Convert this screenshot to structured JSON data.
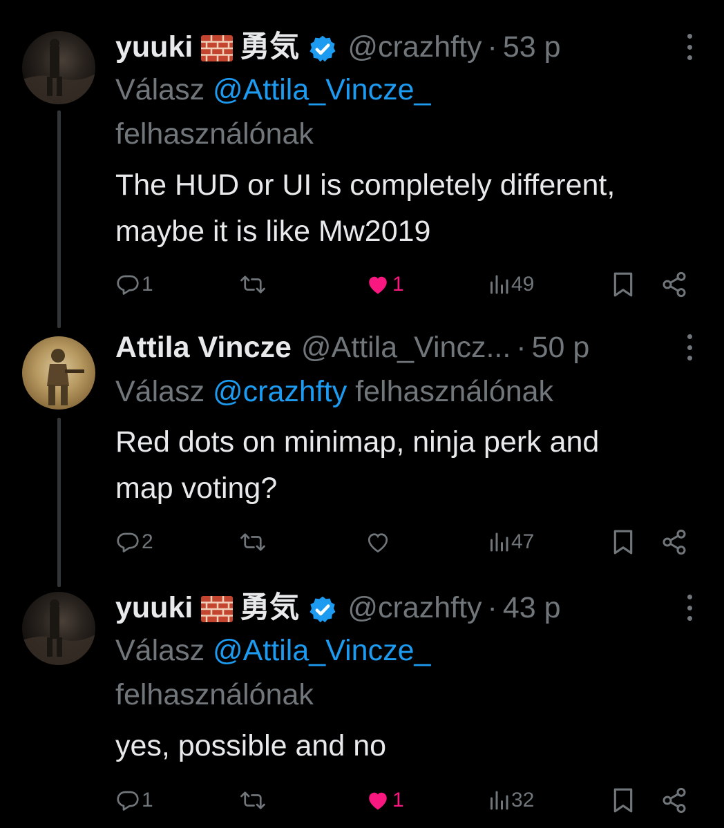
{
  "tweets": [
    {
      "name": "yuuki",
      "kanji": "勇気",
      "handle": "@crazhfty",
      "time": "53 p",
      "reply_prefix": "Válasz",
      "reply_mention": "@Attila_Vincze_",
      "reply_suffix": "felhasználónak",
      "text_lines": [
        "The HUD or UI is completely different,",
        "maybe it is like Mw2019"
      ],
      "replies": "1",
      "reposts": "",
      "likes": "1",
      "liked": true,
      "views": "49"
    },
    {
      "name": "Attila Vincze",
      "handle": "@Attila_Vincz...",
      "time": "50 p",
      "reply_prefix": "Válasz",
      "reply_mention": "@crazhfty",
      "reply_suffix": "felhasználónak",
      "text_lines": [
        "Red dots on minimap, ninja perk and",
        "map voting?"
      ],
      "replies": "2",
      "reposts": "",
      "likes": "",
      "liked": false,
      "views": "47"
    },
    {
      "name": "yuuki",
      "kanji": "勇気",
      "handle": "@crazhfty",
      "time": "43 p",
      "reply_prefix": "Válasz",
      "reply_mention": "@Attila_Vincze_",
      "reply_suffix": "felhasználónak",
      "text_lines": [
        "yes, possible and no"
      ],
      "replies": "1",
      "reposts": "",
      "likes": "1",
      "liked": true,
      "views": "32"
    }
  ],
  "separator": "·",
  "icons": {
    "reply": "reply-icon",
    "repost": "repost-icon",
    "like": "heart-icon",
    "views": "views-icon",
    "bookmark": "bookmark-icon",
    "share": "share-icon",
    "more": "more-icon",
    "verified": "verified-badge-icon",
    "emoji": "brick-emoji-icon"
  },
  "colors": {
    "background": "#000000",
    "text": "#e7e9ea",
    "secondary": "#71767b",
    "mention": "#1d9bf0",
    "like": "#f91880",
    "verified": "#1d9bf0"
  }
}
